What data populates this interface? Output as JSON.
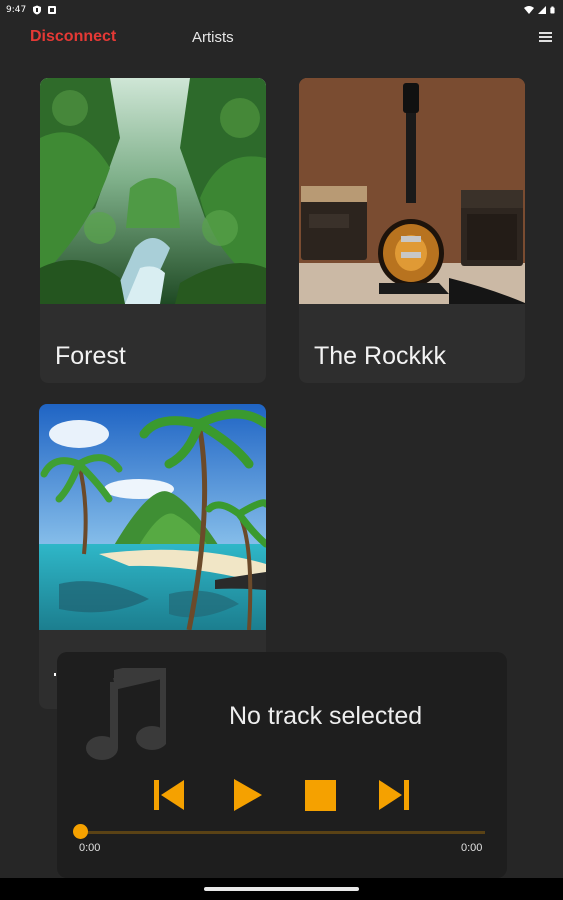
{
  "status_bar": {
    "time": "9:47"
  },
  "nav": {
    "disconnect_label": "Disconnect",
    "artists_label": "Artists",
    "menu_icon": "hamburger-menu-icon"
  },
  "albums": [
    {
      "title": "Forest",
      "art": "jungle-river-artwork"
    },
    {
      "title": "The Rockkk",
      "art": "electric-guitar-amps-artwork"
    },
    {
      "title": "",
      "art": "tropical-island-beach-artwork"
    }
  ],
  "player": {
    "track_title": "No track selected",
    "time_current": "0:00",
    "time_total": "0:00",
    "progress": 0,
    "icons": [
      "music-note-icon",
      "skip-previous-icon",
      "play-icon",
      "stop-icon",
      "skip-next-icon"
    ]
  },
  "colors": {
    "background": "#262626",
    "card": "#2e2e2e",
    "player": "#1e1e1e",
    "accent_red": "#e53935",
    "accent_orange": "#f5a100"
  }
}
